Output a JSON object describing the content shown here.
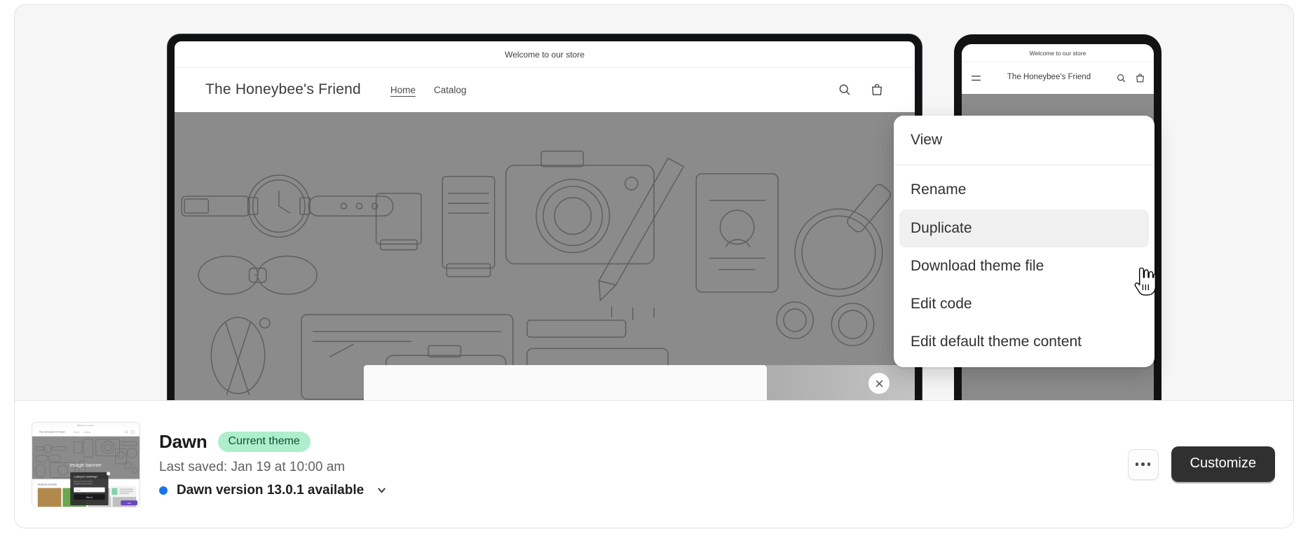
{
  "preview": {
    "desktop": {
      "announcement": "Welcome to our store",
      "store_name": "The Honeybee's Friend",
      "nav": [
        {
          "label": "Home",
          "active": true
        },
        {
          "label": "Catalog",
          "active": false
        }
      ],
      "icons": [
        "search-icon",
        "cart-icon"
      ]
    },
    "mobile": {
      "announcement": "Welcome to our store",
      "store_name": "The Honeybee's Friend",
      "icons": [
        "menu-icon",
        "search-icon",
        "cart-icon"
      ]
    },
    "popup": {
      "close_label": "close-icon"
    }
  },
  "theme": {
    "name": "Dawn",
    "badge": "Current theme",
    "last_saved": "Last saved: Jan 19 at 10:00 am",
    "version_notice": "Dawn version 13.0.1 available",
    "version_dot_color": "#1a73e8",
    "badge_bg": "#aeeecd",
    "badge_fg": "#0f5132"
  },
  "actions": {
    "more_label": "More actions",
    "customize_label": "Customize",
    "customize_bg": "#303030"
  },
  "menu": {
    "items": [
      {
        "label": "View",
        "highlighted": false,
        "separator_after": true
      },
      {
        "label": "Rename",
        "highlighted": false,
        "separator_after": false
      },
      {
        "label": "Duplicate",
        "highlighted": true,
        "separator_after": false
      },
      {
        "label": "Download theme file",
        "highlighted": false,
        "separator_after": false
      },
      {
        "label": "Edit code",
        "highlighted": false,
        "separator_after": false
      },
      {
        "label": "Edit default theme content",
        "highlighted": false,
        "separator_after": false
      }
    ]
  },
  "thumbnail": {
    "banner_label": "Image banner",
    "section_label": "Featured products",
    "popup_title": "Looking for something?",
    "popup_input_placeholder": "Email",
    "popup_button": "Sign up"
  }
}
